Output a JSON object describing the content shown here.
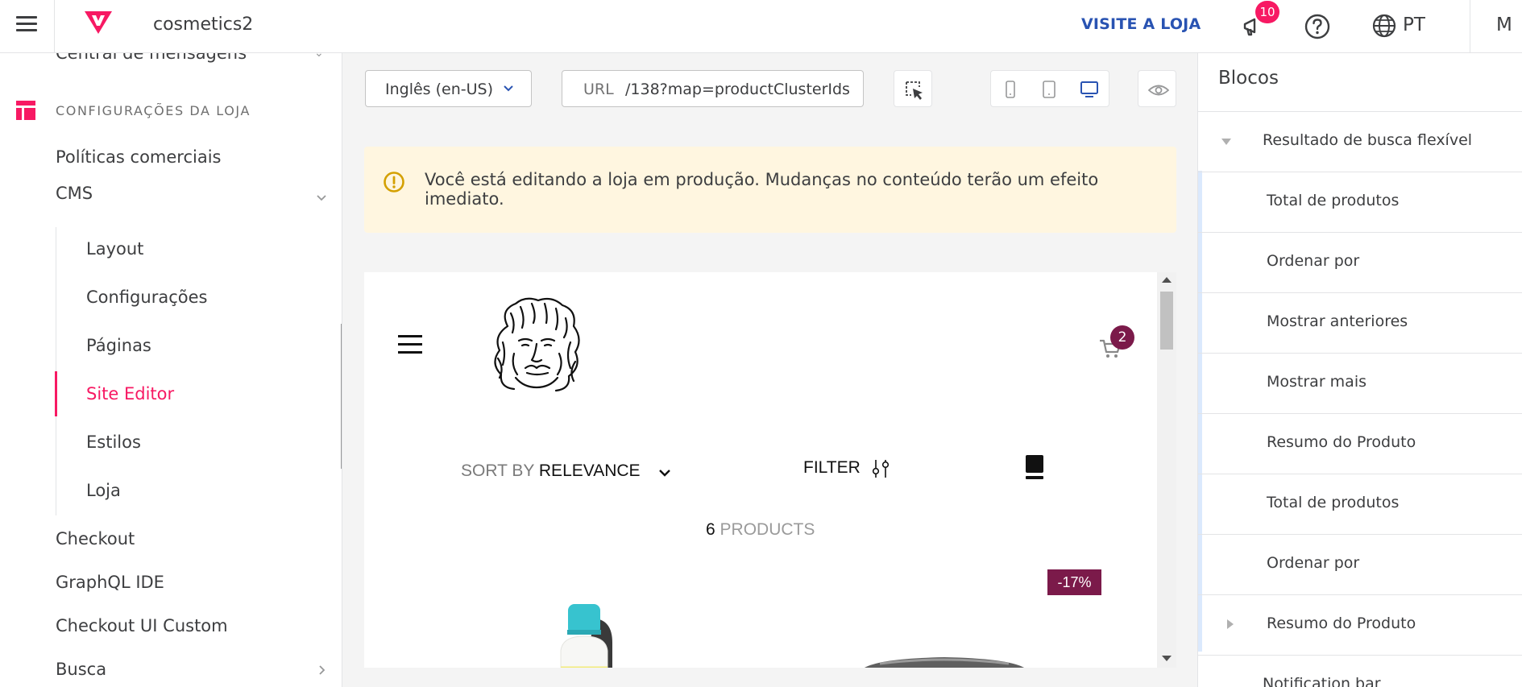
{
  "topbar": {
    "account": "cosmetics2",
    "visit_store": "VISITE A LOJA",
    "notifications_count": "10",
    "language": "PT",
    "user_initial": "M"
  },
  "sidebar": {
    "cutoff_item": "Central de mensagens",
    "section_title": "CONFIGURAÇÕES DA LOJA",
    "items": [
      {
        "label": "Políticas comerciais"
      },
      {
        "label": "CMS"
      },
      {
        "label": "Checkout"
      },
      {
        "label": "GraphQL IDE"
      },
      {
        "label": "Checkout UI Custom"
      },
      {
        "label": "Busca"
      }
    ],
    "cms_children": [
      {
        "label": "Layout"
      },
      {
        "label": "Configurações"
      },
      {
        "label": "Páginas"
      },
      {
        "label": "Site Editor",
        "active": true
      },
      {
        "label": "Estilos"
      },
      {
        "label": "Loja"
      }
    ]
  },
  "editor": {
    "locale_value": "Inglês (en-US)",
    "url_label": "URL",
    "url_value": "/138?map=productClusterIds",
    "notice": "Você está editando a loja em produção. Mudanças no conteúdo terão um efeito imediato."
  },
  "preview": {
    "cart_count": "2",
    "sort_prefix": "SORT BY ",
    "sort_value": "RELEVANCE",
    "filter_label": "FILTER",
    "products_count": "6",
    "products_label": " PRODUCTS",
    "discount": "-17%"
  },
  "blocks": {
    "title": "Blocos",
    "items": [
      {
        "label": "Resultado de busca flexível"
      },
      {
        "label": "Total de produtos"
      },
      {
        "label": "Ordenar por"
      },
      {
        "label": "Mostrar anteriores"
      },
      {
        "label": "Mostrar mais"
      },
      {
        "label": "Resumo do Produto"
      },
      {
        "label": "Total de produtos"
      },
      {
        "label": "Ordenar por"
      },
      {
        "label": "Resumo do Produto"
      },
      {
        "label": "Notification bar"
      }
    ]
  },
  "colors": {
    "brand_pink": "#f71963",
    "link_blue": "#2953b2",
    "notice_bg": "#fff6e0",
    "badge_wine": "#7b1a4a"
  }
}
